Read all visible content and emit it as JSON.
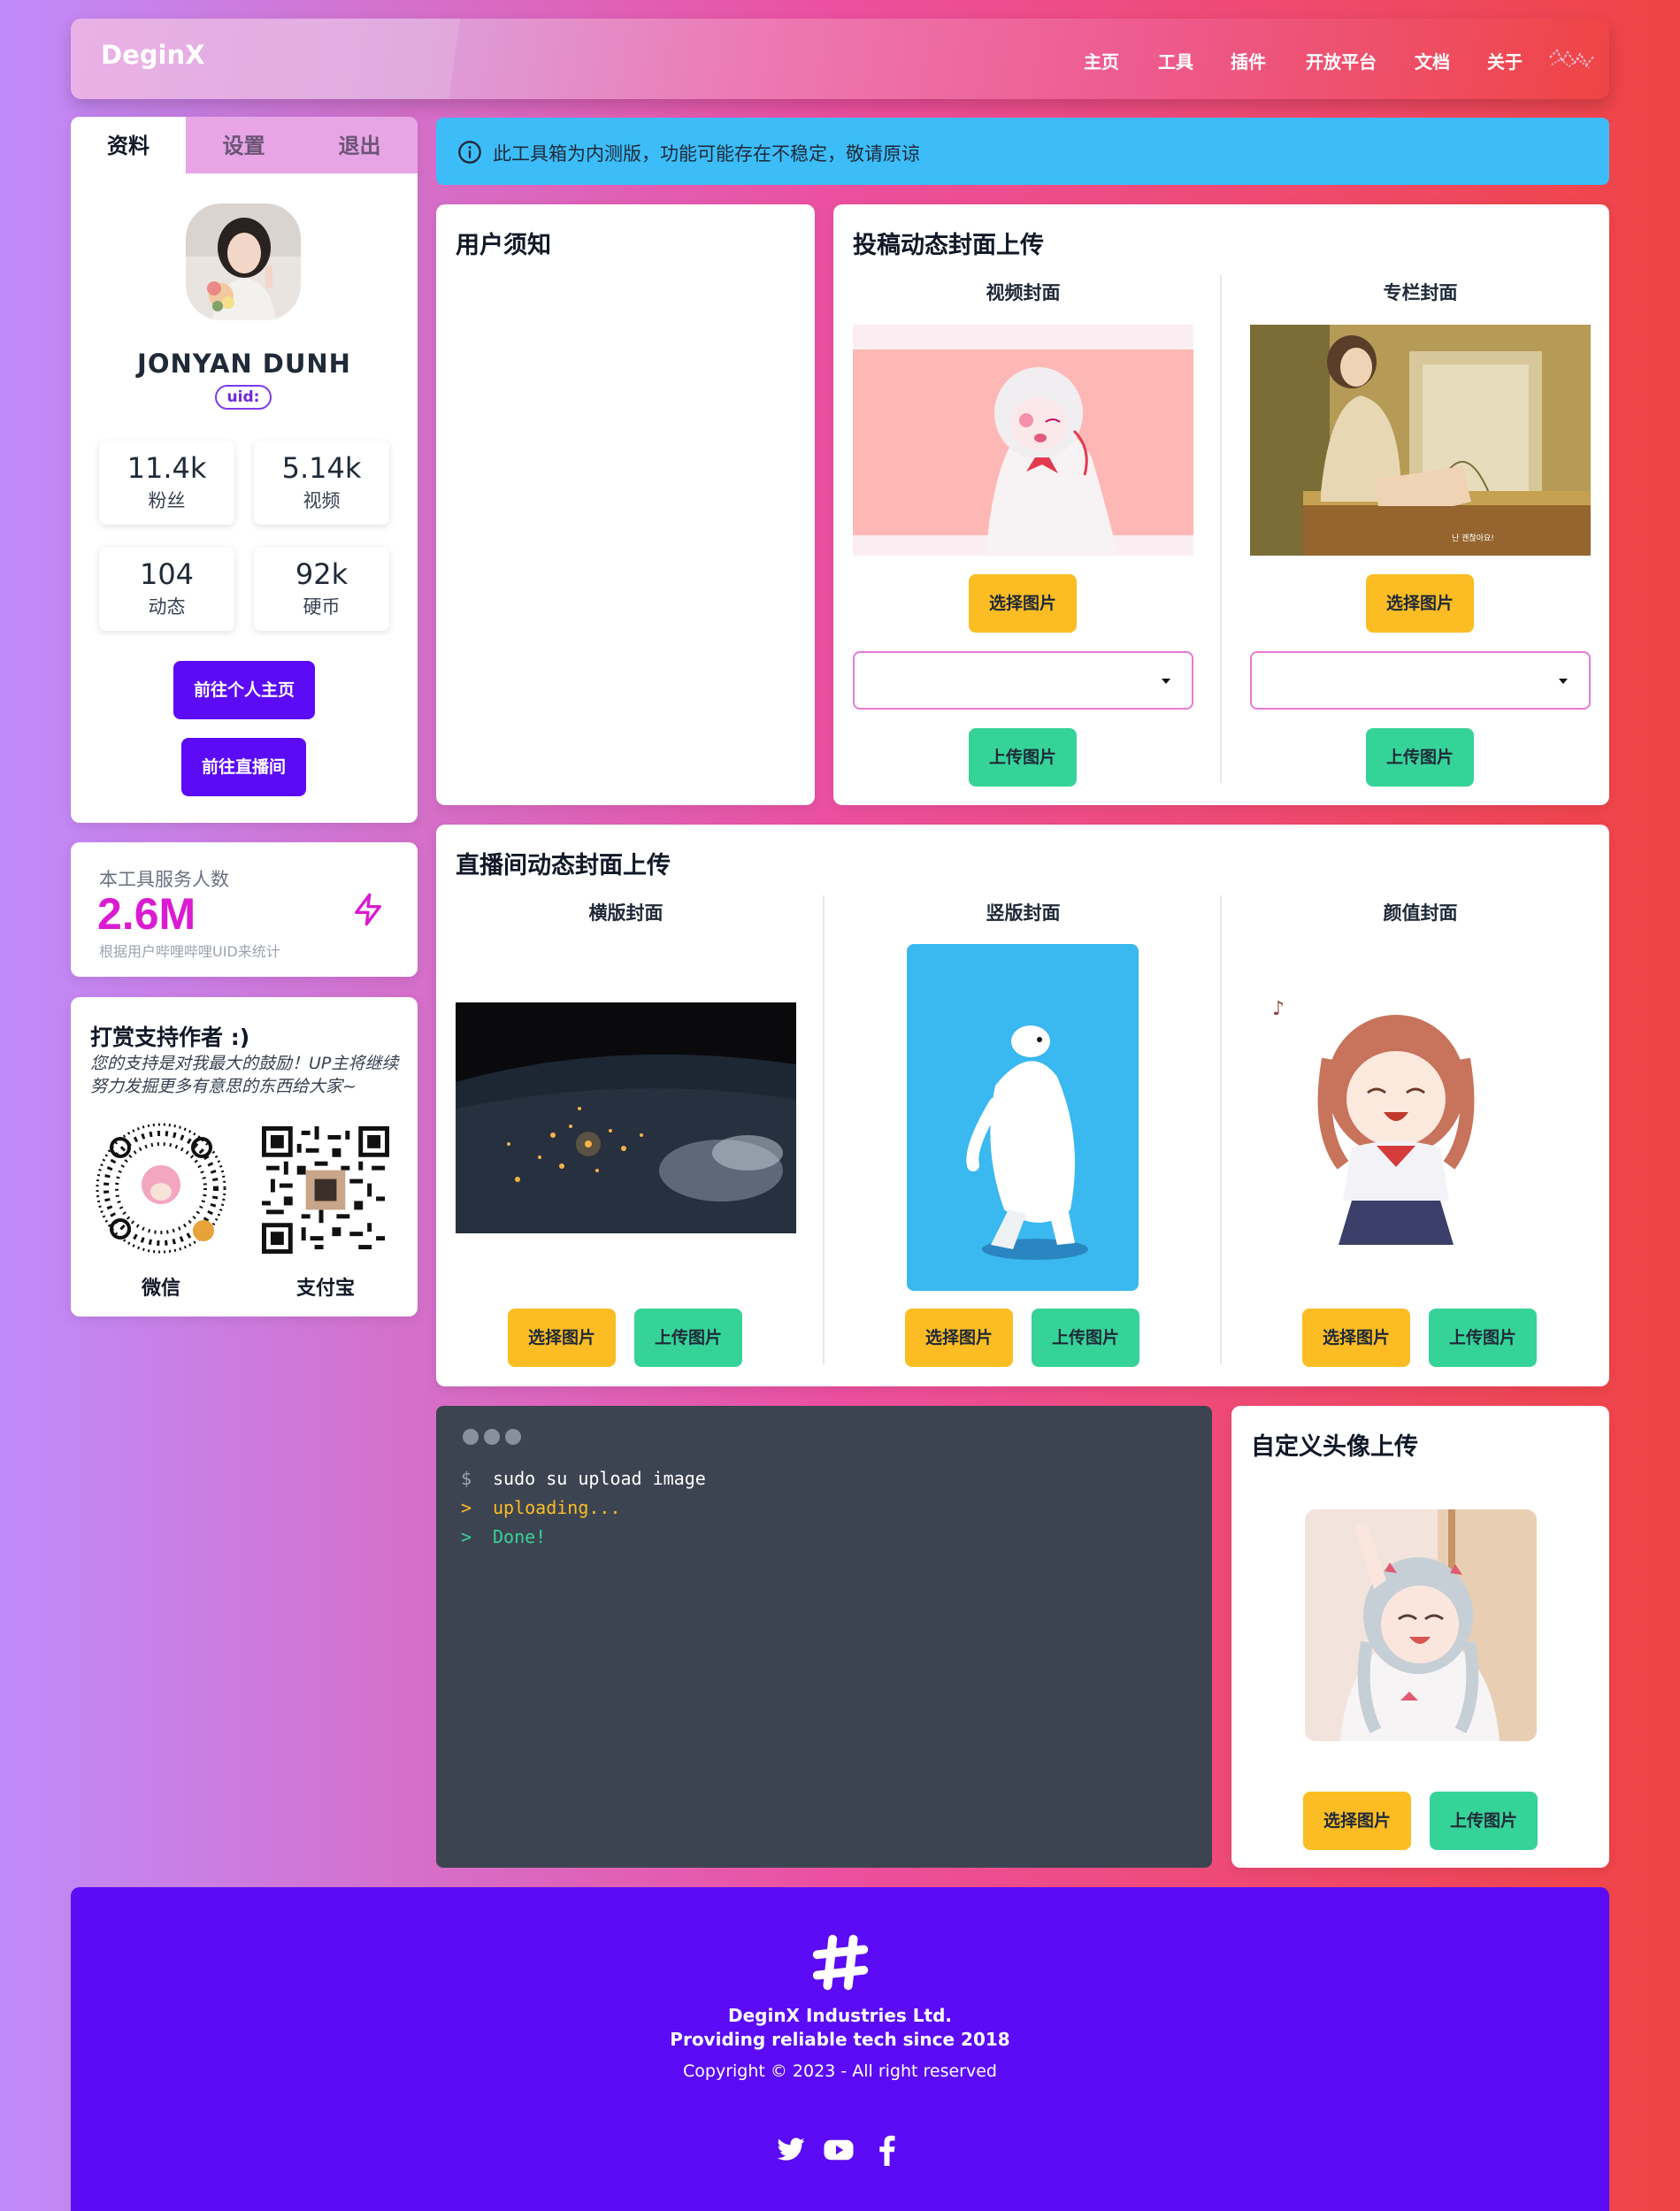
{
  "navbar": {
    "brand": "DeginX",
    "items": [
      "主页",
      "工具",
      "插件",
      "开放平台",
      "文档",
      "关于"
    ]
  },
  "sidebar": {
    "tabs": [
      "资料",
      "设置",
      "退出"
    ],
    "name": "JONYAN DUNH",
    "uid_label": "uid:",
    "stats": [
      {
        "value": "11.4k",
        "label": "粉丝"
      },
      {
        "value": "5.14k",
        "label": "视频"
      },
      {
        "value": "104",
        "label": "动态"
      },
      {
        "value": "92k",
        "label": "硬币"
      }
    ],
    "btn_homepage": "前往个人主页",
    "btn_live": "前往直播间"
  },
  "service": {
    "title": "本工具服务人数",
    "value": "2.6M",
    "desc": "根据用户哔哩哔哩UID来统计"
  },
  "donate": {
    "title": "打赏支持作者 :)",
    "text": "您的支持是对我最大的鼓励！UP主将继续努力发掘更多有意思的东西给大家~",
    "wechat_label": "微信",
    "alipay_label": "支付宝"
  },
  "notice": {
    "text": "此工具箱为内测版，功能可能存在不稳定，敬请原谅"
  },
  "user_notice": {
    "title": "用户须知"
  },
  "cover_upload": {
    "title": "投稿动态封面上传",
    "video_cover": "视频封面",
    "column_cover": "专栏封面",
    "choose_label": "选择图片",
    "upload_label": "上传图片",
    "select_value": ""
  },
  "live_upload": {
    "title": "直播间动态封面上传",
    "landscape": "横版封面",
    "portrait": "竖版封面",
    "looks": "颜值封面",
    "choose_label": "选择图片",
    "upload_label": "上传图片"
  },
  "terminal": {
    "lines": [
      {
        "prompt": "$",
        "text": "sudo su upload image",
        "color": "#ffffff"
      },
      {
        "prompt": ">",
        "text": "uploading...",
        "color": "#fbbd23"
      },
      {
        "prompt": ">",
        "text": "Done!",
        "color": "#36d399"
      }
    ]
  },
  "avatar_upload": {
    "title": "自定义头像上传",
    "choose_label": "选择图片",
    "upload_label": "上传图片"
  },
  "footer": {
    "company": "DeginX Industries Ltd.",
    "tagline": "Providing reliable tech since 2018",
    "copyright": "Copyright © 2023 - All right reserved",
    "social_icons": [
      "twitter-icon",
      "youtube-icon",
      "facebook-icon"
    ]
  },
  "colors": {
    "primary": "#5b0bf5",
    "warning": "#fbbd23",
    "success": "#36d399",
    "info": "#3cbdf8",
    "accent": "#db1bd1"
  }
}
